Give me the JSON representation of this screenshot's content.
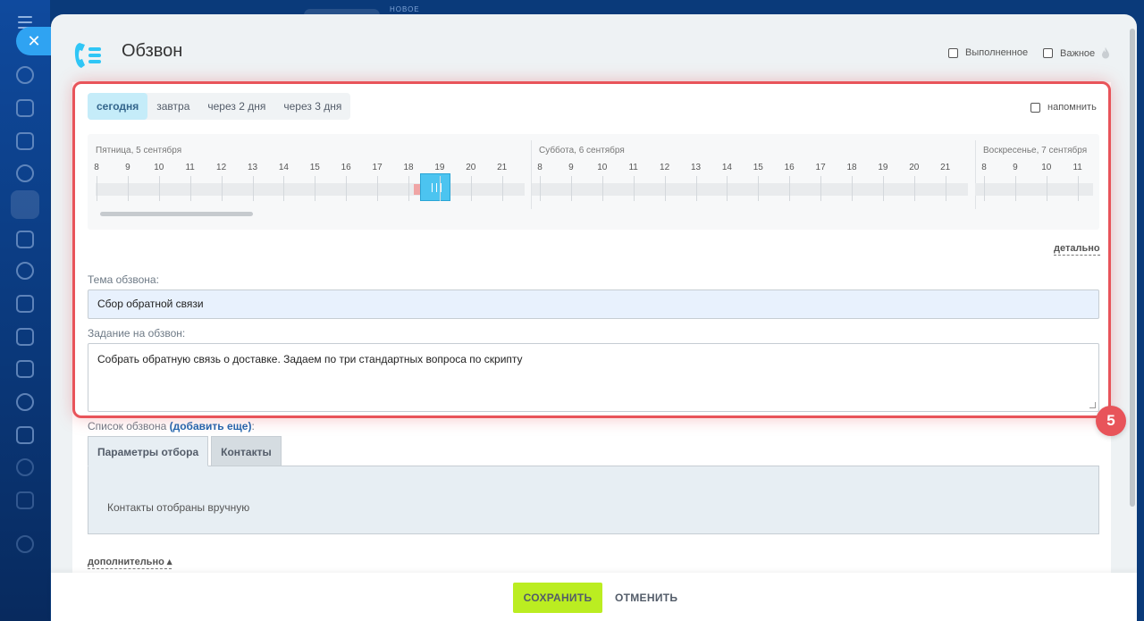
{
  "topbar": {
    "new_badge": "НОВОЕ"
  },
  "header": {
    "title": "Обзвон",
    "checkbox_completed": "Выполненное",
    "checkbox_important": "Важное"
  },
  "day_tabs": [
    {
      "label": "сегодня",
      "active": true
    },
    {
      "label": "завтра"
    },
    {
      "label": "через 2 дня"
    },
    {
      "label": "через 3 дня"
    }
  ],
  "remind_label": "напомнить",
  "timeline": {
    "days": [
      {
        "label": "Пятница, 5 сентября",
        "hours": [
          "8",
          "9",
          "10",
          "11",
          "12",
          "13",
          "14",
          "15",
          "16",
          "17",
          "18",
          "19",
          "20",
          "21"
        ]
      },
      {
        "label": "Суббота, 6 сентября",
        "hours": [
          "8",
          "9",
          "10",
          "11",
          "12",
          "13",
          "14",
          "15",
          "16",
          "17",
          "18",
          "19",
          "20",
          "21"
        ]
      },
      {
        "label": "Воскресенье, 7 сентября",
        "hours": [
          "8",
          "9",
          "10",
          "11"
        ]
      }
    ]
  },
  "details_link": "детально",
  "form": {
    "topic_label": "Тема обзвона:",
    "topic_value": "Сбор обратной связи",
    "task_label": "Задание на обзвон:",
    "task_value": "Собрать обратную связь о доставке. Задаем по три стандартных вопроса по скрипту"
  },
  "call_list": {
    "label": "Список обзвона",
    "add_more": "(добавить еще)",
    "colon": ":",
    "tabs": [
      {
        "label": "Параметры отбора",
        "active": true
      },
      {
        "label": "Контакты"
      }
    ],
    "body_text": "Контакты отобраны вручную"
  },
  "more_link": "дополнительно",
  "step_badge": "5",
  "footer": {
    "save": "СОХРАНИТЬ",
    "cancel": "ОТМЕНИТЬ"
  },
  "colors": {
    "accent_green": "#bbed21",
    "highlight_red": "#e8545a",
    "selection_blue": "#4cc4f0",
    "logo_blue": "#2fc6f6"
  }
}
